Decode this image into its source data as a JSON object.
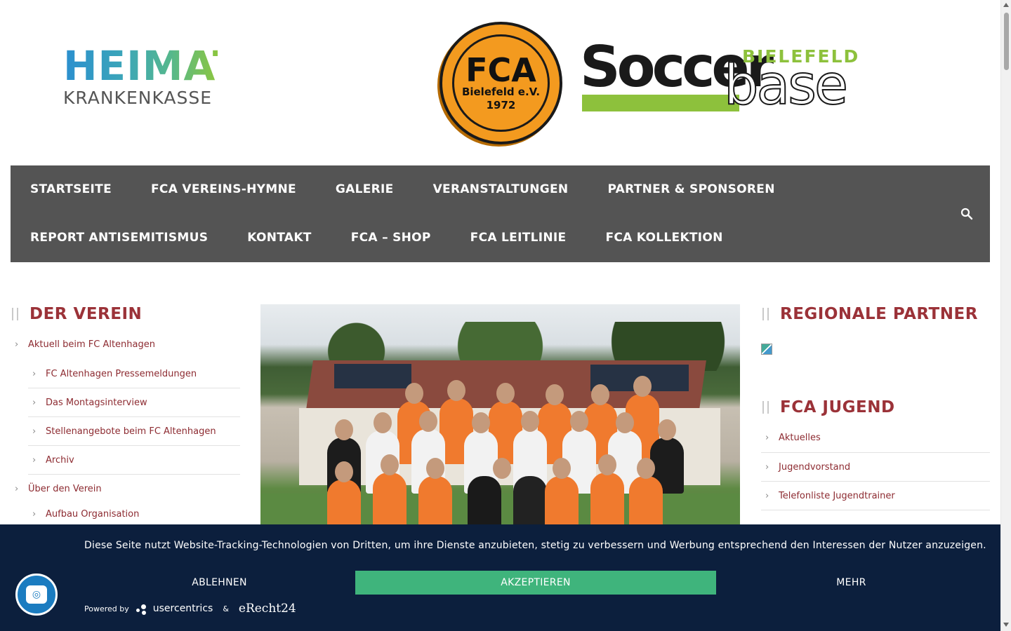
{
  "header": {
    "sponsor_logo": {
      "line1": "HEIMAT",
      "line2": "KRANKENKASSE"
    },
    "club_logo": {
      "big": "FCA",
      "line2": "Bielefeld e.V.",
      "line3": "1972"
    },
    "soccerbase_logo": {
      "word1": "Soccer",
      "word2": "BIELEFELD",
      "word3": "base"
    }
  },
  "nav": {
    "row1": [
      "STARTSEITE",
      "FCA VEREINS-HYMNE",
      "GALERIE",
      "VERANSTALTUNGEN",
      "PARTNER & SPONSOREN"
    ],
    "row2": [
      "REPORT ANTISEMITISMUS",
      "KONTAKT",
      "FCA – SHOP",
      "FCA LEITLINIE",
      "FCA KOLLEKTION"
    ],
    "search_icon": "search-icon"
  },
  "left_sidebar": {
    "title": "DER VEREIN",
    "items": [
      {
        "label": "Aktuell beim FC Altenhagen",
        "level": 0
      },
      {
        "label": "FC Altenhagen Pressemeldungen",
        "level": 1
      },
      {
        "label": "Das Montagsinterview",
        "level": 1
      },
      {
        "label": "Stellenangebote beim FC Altenhagen",
        "level": 1
      },
      {
        "label": "Archiv",
        "level": 1
      },
      {
        "label": "Über den Verein",
        "level": 0
      },
      {
        "label": "Aufbau Organisation",
        "level": 1
      }
    ]
  },
  "right_sidebar": {
    "partner_title": "REGIONALE PARTNER",
    "youth_title": "FCA JUGEND",
    "youth_items": [
      "Aktuelles",
      "Jugendvorstand",
      "Telefonliste Jugendtrainer"
    ]
  },
  "cookie": {
    "text": "Diese Seite nutzt Website-Tracking-Technologien von Dritten, um ihre Dienste anzubieten, stetig zu verbessern und Werbung entsprechend den Interessen der Nutzer anzuzeigen.",
    "decline": "ABLEHNEN",
    "accept": "AKZEPTIEREN",
    "more": "MEHR",
    "powered_by": "Powered by",
    "usercentrics": "usercentrics",
    "amp": "&",
    "erecht": "eRecht24",
    "accent_color": "#3fb47c",
    "bg_color": "#0c1f3d"
  },
  "colors": {
    "nav_bg": "#545454",
    "heading": "#9b3238",
    "link": "#8d2b31"
  }
}
